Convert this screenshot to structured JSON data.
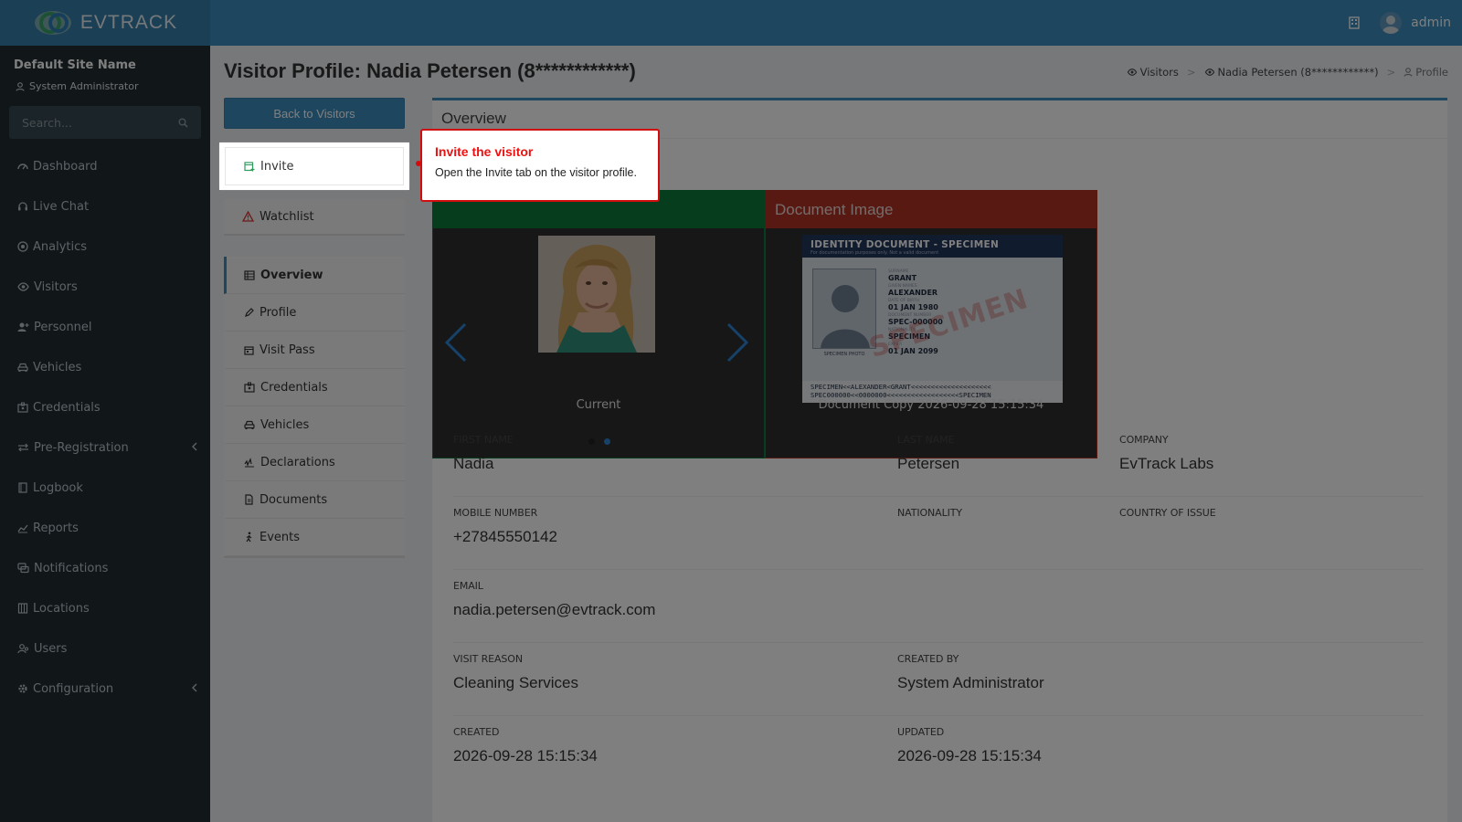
{
  "header": {
    "brand": "EVTRACK",
    "user": "admin"
  },
  "sidebar": {
    "site_name": "Default Site Name",
    "role": "System Administrator",
    "search_placeholder": "Search...",
    "items": [
      {
        "label": "Dashboard",
        "icon": "dashboard-icon"
      },
      {
        "label": "Live Chat",
        "icon": "headset-icon"
      },
      {
        "label": "Analytics",
        "icon": "target-icon"
      },
      {
        "label": "Visitors",
        "icon": "eye-icon"
      },
      {
        "label": "Personnel",
        "icon": "user-plus-icon"
      },
      {
        "label": "Vehicles",
        "icon": "car-icon"
      },
      {
        "label": "Credentials",
        "icon": "id-card-icon"
      },
      {
        "label": "Pre-Registration",
        "icon": "exchange-icon"
      },
      {
        "label": "Logbook",
        "icon": "book-icon"
      },
      {
        "label": "Reports",
        "icon": "chart-icon"
      },
      {
        "label": "Notifications",
        "icon": "comments-icon"
      },
      {
        "label": "Locations",
        "icon": "building-icon"
      },
      {
        "label": "Users",
        "icon": "users-icon"
      },
      {
        "label": "Configuration",
        "icon": "cog-icon"
      }
    ]
  },
  "page": {
    "title": "Visitor Profile: Nadia Petersen (8************)",
    "breadcrumb": [
      "Visitors",
      "Nadia Petersen (8************)",
      "Profile"
    ]
  },
  "actions": {
    "back": "Back to Visitors",
    "invite": "Invite",
    "watchlist": "Watchlist"
  },
  "tabs": [
    {
      "label": "Overview",
      "icon": "table-icon",
      "active": true
    },
    {
      "label": "Profile",
      "icon": "pencil-icon"
    },
    {
      "label": "Visit Pass",
      "icon": "calendar-icon"
    },
    {
      "label": "Credentials",
      "icon": "id-card-icon"
    },
    {
      "label": "Vehicles",
      "icon": "car-icon"
    },
    {
      "label": "Declarations",
      "icon": "signature-icon"
    },
    {
      "label": "Documents",
      "icon": "file-icon"
    },
    {
      "label": "Events",
      "icon": "walking-icon"
    }
  ],
  "overview": {
    "title": "Overview",
    "photo_caption": "Current",
    "document_title": "Document Image",
    "document_caption": "Document Copy 2026-09-28 15:15:34",
    "id_card": {
      "title": "IDENTITY DOCUMENT - SPECIMEN",
      "subtitle": "For documentation purposes only. Not a valid document",
      "photo_label": "SPECIMEN PHOTO",
      "watermark": "SPECIMEN",
      "fields": [
        {
          "label": "Surname",
          "value": "GRANT"
        },
        {
          "label": "Given names",
          "value": "ALEXANDER"
        },
        {
          "label": "Date of birth",
          "value": "01 JAN 1980"
        },
        {
          "label": "Document number",
          "value": "SPEC-000000"
        },
        {
          "label": "Nationality",
          "value": "SPECIMEN"
        },
        {
          "label": "Expiry",
          "value": "01 JAN 2099"
        }
      ],
      "mrz1": "SPECIMEN<<ALEXANDER<GRANT<<<<<<<<<<<<<<<<<<<<",
      "mrz2": "SPEC000000<<0000000<<<<<<<<<<<<<<<<<<SPECIMEN"
    },
    "fields": {
      "first_name": {
        "label": "FIRST NAME",
        "value": "Nadia"
      },
      "last_name": {
        "label": "LAST NAME",
        "value": "Petersen"
      },
      "company": {
        "label": "COMPANY",
        "value": "EvTrack Labs"
      },
      "mobile": {
        "label": "MOBILE NUMBER",
        "value": "+27845550142"
      },
      "nationality": {
        "label": "NATIONALITY",
        "value": ""
      },
      "country_of_issue": {
        "label": "COUNTRY OF ISSUE",
        "value": ""
      },
      "email": {
        "label": "EMAIL",
        "value": "nadia.petersen@evtrack.com"
      },
      "visit_reason": {
        "label": "VISIT REASON",
        "value": "Cleaning Services"
      },
      "created_by": {
        "label": "CREATED BY",
        "value": "System Administrator"
      },
      "created": {
        "label": "CREATED",
        "value": "2026-09-28 15:15:34"
      },
      "updated": {
        "label": "UPDATED",
        "value": "2026-09-28 15:15:34"
      }
    }
  },
  "tooltip": {
    "title": "Invite the visitor",
    "body": "Open the Invite tab on the visitor profile."
  },
  "colors": {
    "header": "#3c8dbc",
    "sidebar": "#222d32",
    "photo_header": "#0c7a3a",
    "document_header": "#b03225",
    "tooltip_border": "#d10d10"
  }
}
